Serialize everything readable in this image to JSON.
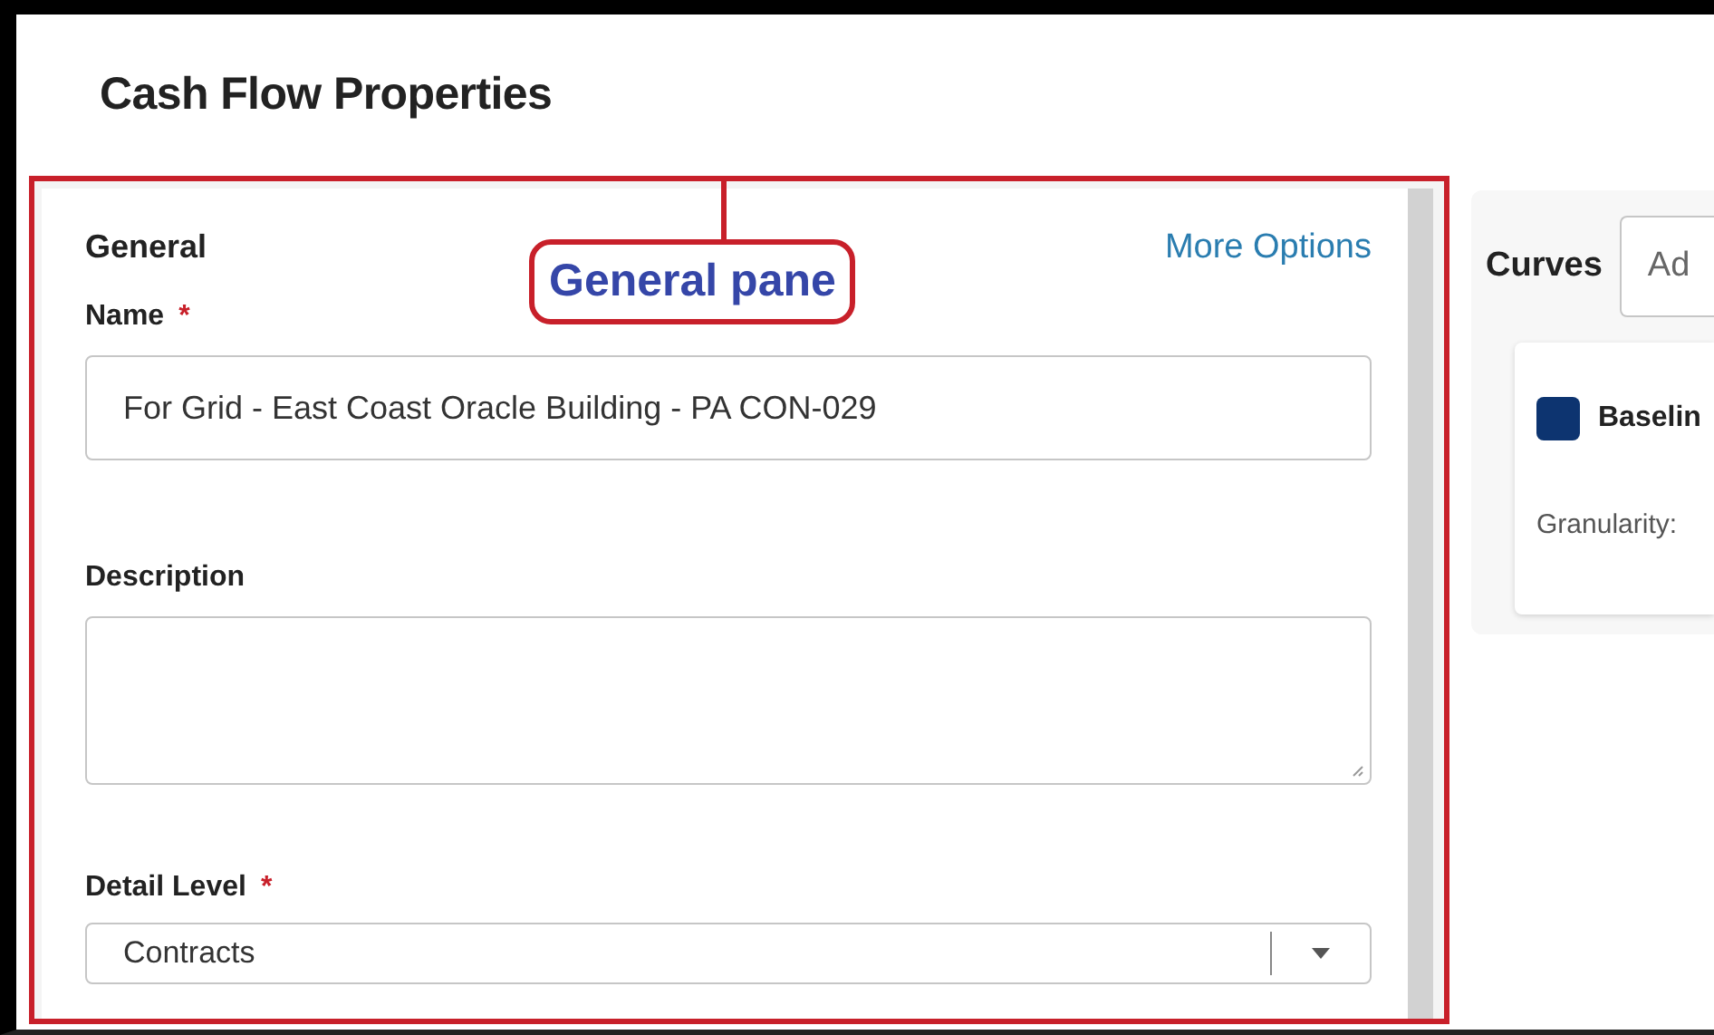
{
  "dialog": {
    "title": "Cash Flow Properties"
  },
  "general": {
    "heading": "General",
    "more_options": "More Options",
    "fields": [
      {
        "kind": "input",
        "label": "Name",
        "required_mark": "*",
        "value": "For Grid - East Coast Oracle Building - PA CON-029"
      },
      {
        "kind": "textarea",
        "label": "Description"
      },
      {
        "kind": "select",
        "label": "Detail Level",
        "required_mark": "*",
        "value": "Contracts"
      }
    ]
  },
  "annotation": {
    "label": "General pane"
  },
  "curves": {
    "label": "Curves",
    "add_placeholder": "Ad",
    "items": [
      {
        "name": "Baselin",
        "color": "#0d3470",
        "granularity_label": "Granularity:"
      }
    ]
  }
}
